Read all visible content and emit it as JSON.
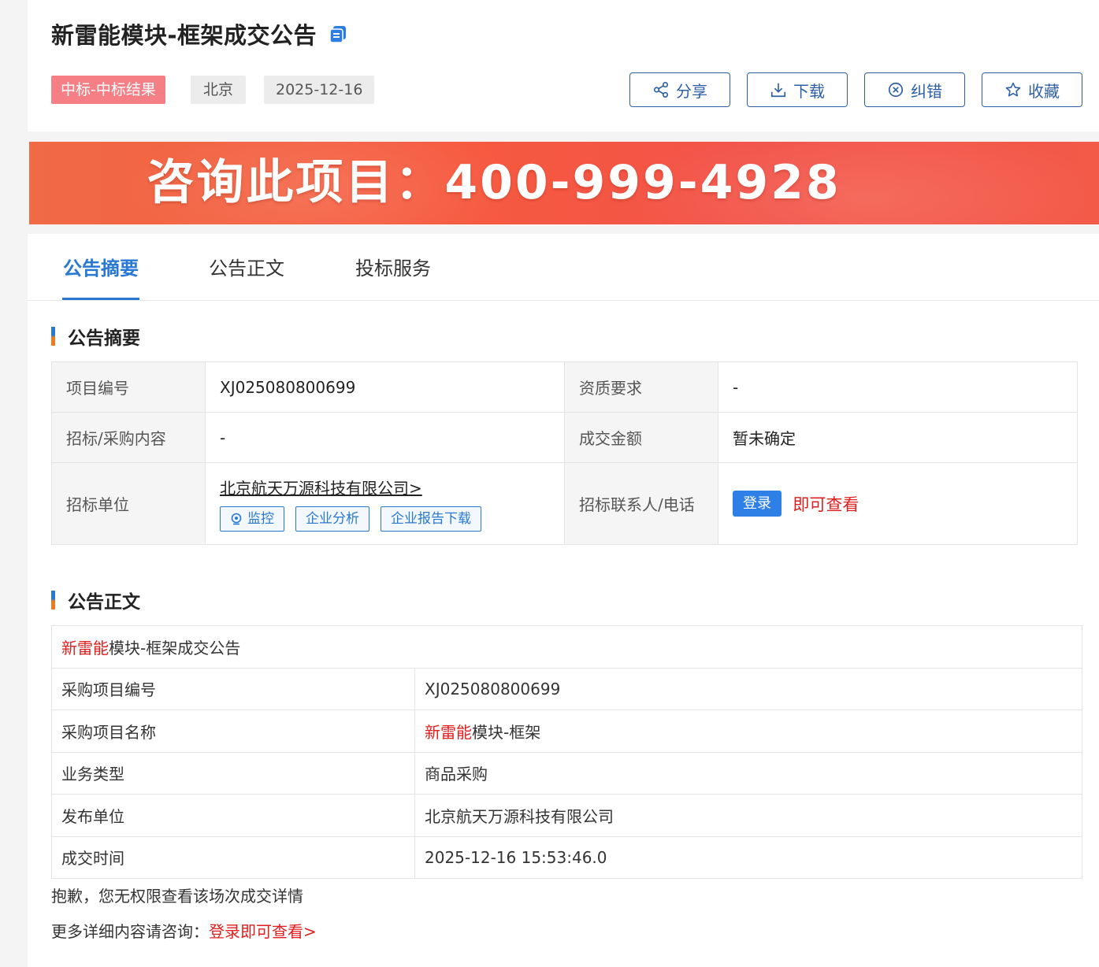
{
  "header": {
    "title": "新雷能模块-框架成交公告",
    "tags": {
      "status": "中标-中标结果",
      "region": "北京",
      "date": "2025-12-16"
    },
    "actions": {
      "share": "分享",
      "download": "下载",
      "report_error": "纠错",
      "favorite": "收藏"
    }
  },
  "banner": {
    "text": "咨询此项目：400-999-4928"
  },
  "tabs": {
    "summary": "公告摘要",
    "body": "公告正文",
    "service": "投标服务"
  },
  "summary_section": {
    "title": "公告摘要",
    "rows": {
      "project_no_label": "项目编号",
      "project_no_value": "XJ025080800699",
      "qualification_label": "资质要求",
      "qualification_value": "-",
      "content_label": "招标/采购内容",
      "content_value": "-",
      "amount_label": "成交金额",
      "amount_value": "暂未确定",
      "tenderer_label": "招标单位",
      "tenderer_value": "北京航天万源科技有限公司>",
      "contact_label": "招标联系人/电话",
      "monitor_btn": "监控",
      "analysis_btn": "企业分析",
      "report_btn": "企业报告下载",
      "login_btn": "登录",
      "login_hint": "即可查看"
    }
  },
  "body_section": {
    "title": "公告正文",
    "heading_highlight": "新雷能",
    "heading_rest": "模块-框架成交公告",
    "rows": [
      {
        "label": "采购项目编号",
        "value": "XJ025080800699"
      },
      {
        "label": "采购项目名称",
        "value_highlight": "新雷能",
        "value_rest": "模块-框架"
      },
      {
        "label": "业务类型",
        "value": "商品采购"
      },
      {
        "label": "发布单位",
        "value": "北京航天万源科技有限公司"
      },
      {
        "label": "成交时间",
        "value": "2025-12-16 15:53:46.0"
      }
    ],
    "no_permission": "抱歉，您无权限查看该场次成交详情",
    "more_prefix": "更多详细内容请咨询：",
    "more_link": "登录即可查看>"
  },
  "colors": {
    "brand_blue": "#2878d4",
    "accent_red": "#e01e1e",
    "status_tag": "#f57f85",
    "banner": "#f35a48"
  }
}
